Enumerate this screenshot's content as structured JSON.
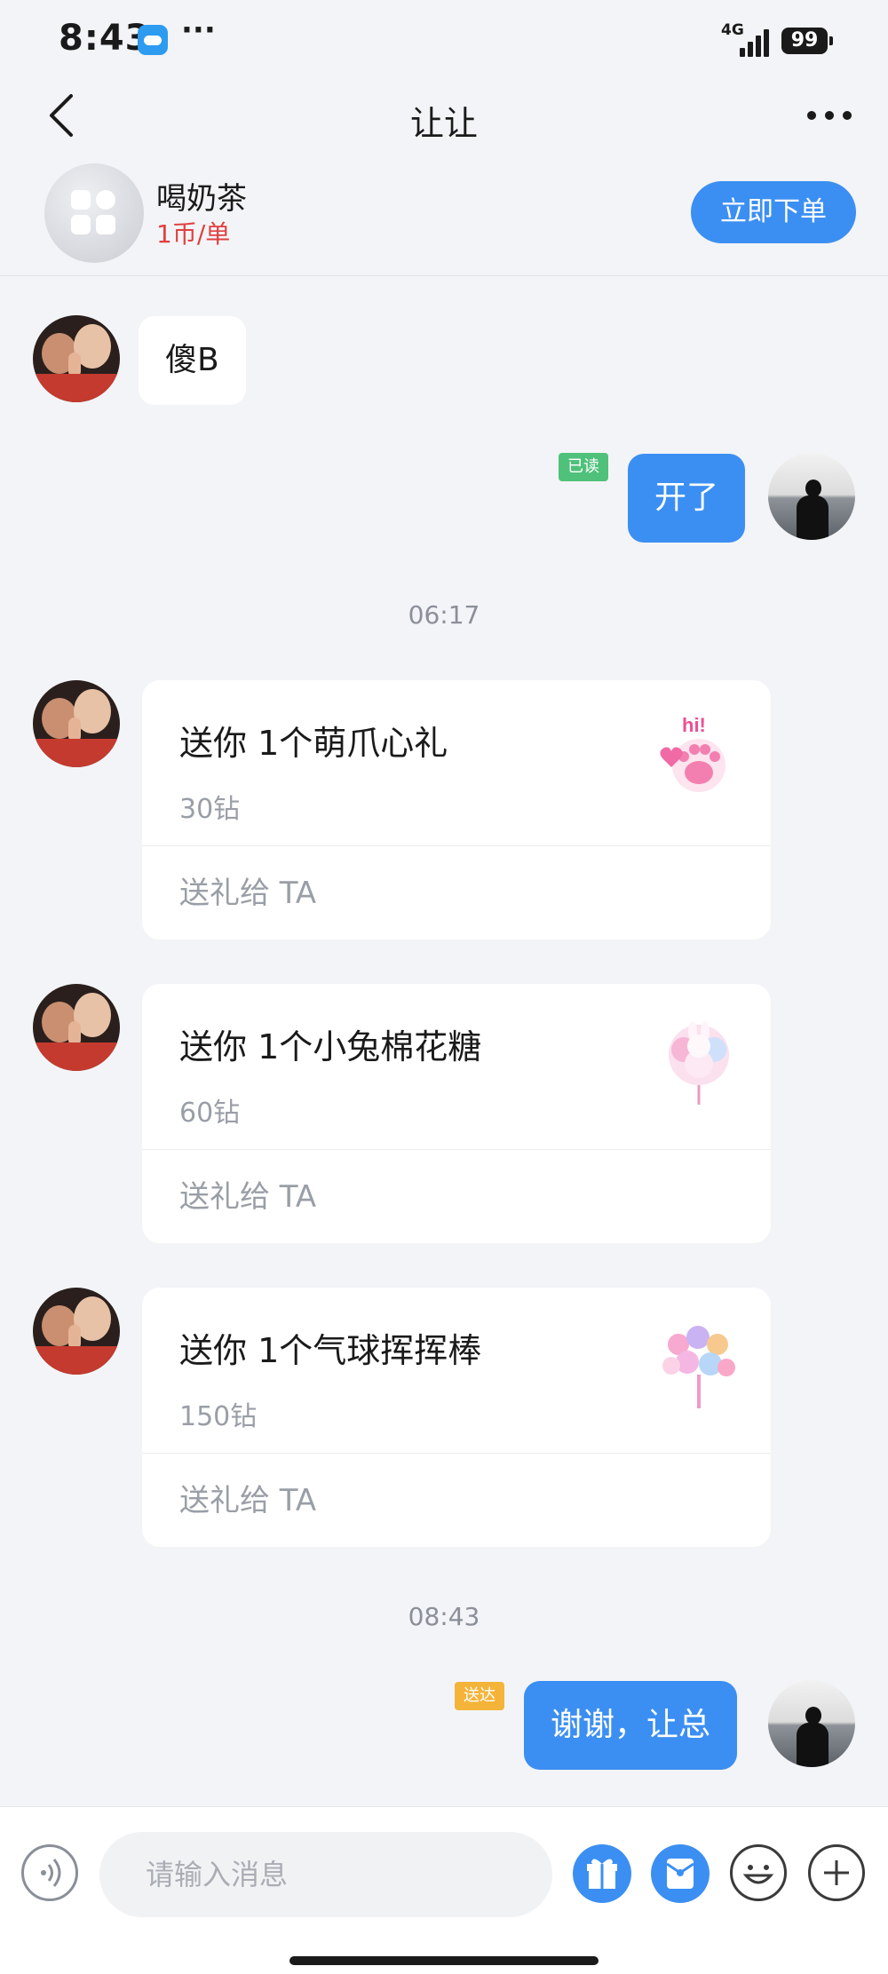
{
  "status_bar": {
    "time": "8:43",
    "dots": "···",
    "network": "4G",
    "battery": "99"
  },
  "header": {
    "title": "让让"
  },
  "order": {
    "service_name": "喝奶茶",
    "price": "1币/单",
    "order_button": "立即下单"
  },
  "messages": {
    "msg1_text": "傻B",
    "msg2_text": "开了",
    "msg2_status": "已读",
    "time1": "06:17",
    "time2": "08:43",
    "msg_last_text": "谢谢，让总",
    "msg_last_status": "送达"
  },
  "gifts": [
    {
      "title": "送你 1个萌爪心礼",
      "cost": "30钻",
      "action": "送礼给 TA"
    },
    {
      "title": "送你 1个小兔棉花糖",
      "cost": "60钻",
      "action": "送礼给 TA"
    },
    {
      "title": "送你 1个气球挥挥棒",
      "cost": "150钻",
      "action": "送礼给 TA"
    }
  ],
  "input": {
    "placeholder": "请输入消息"
  },
  "colors": {
    "accent": "#3c8ff2",
    "price_red": "#e04040",
    "read_green": "#4fc17a",
    "delivered_orange": "#f4b43a",
    "background": "#f3f4f7"
  }
}
